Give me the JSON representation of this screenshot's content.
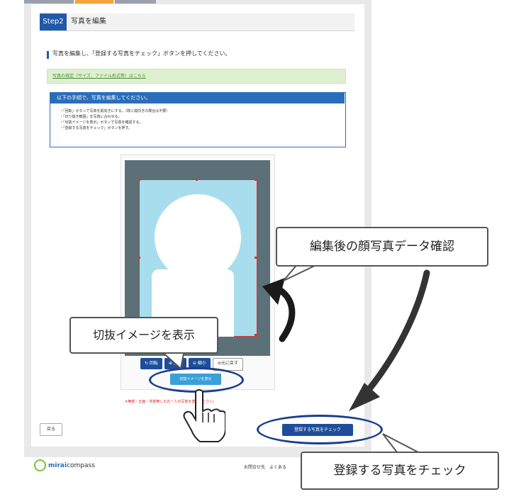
{
  "header": {
    "step_badge": "Step2",
    "step_title": "写真を編集"
  },
  "instruction": "写真を編集し、「登録する写真をチェック」ボタンを押してください。",
  "rules_link": "写真の規定（サイズ、ファイル形式等）はこちら",
  "steps_panel": {
    "title": "以下の手順で、写真を編集してください。",
    "items": [
      "「回転」ボタンで写真を縦向きにする。（既に縦向きの場合は不要）",
      "「切り抜き範囲」を写真に合わせる。",
      "「切抜イメージを表示」ボタンで写真を確認する。",
      "「登録する写真をチェック」ボタンを押す。"
    ]
  },
  "editor": {
    "rotate_label": "回転",
    "zoom_in_label": "拡大",
    "zoom_out_label": "縮小",
    "reset_label": "元に戻す",
    "preview_label": "切抜イメージを表示"
  },
  "warning": "※無帽・正面・背景無しのお一人の写真を登録ください。",
  "actions": {
    "back_label": "戻る",
    "register_label": "登録する写真をチェック"
  },
  "footer": {
    "logo_part1": "mirai",
    "logo_part2": "compass",
    "links": "お問合せ先　よくある"
  },
  "callouts": {
    "edit_confirm": "編集後の顔写真データ確認",
    "preview": "切抜イメージを表示",
    "register": "登録する写真をチェック"
  },
  "colors": {
    "brand_blue": "#1e5aa8",
    "accent_orange": "#f3a43b",
    "photo_bg": "#a8ddee",
    "warning_red": "#e02020"
  }
}
